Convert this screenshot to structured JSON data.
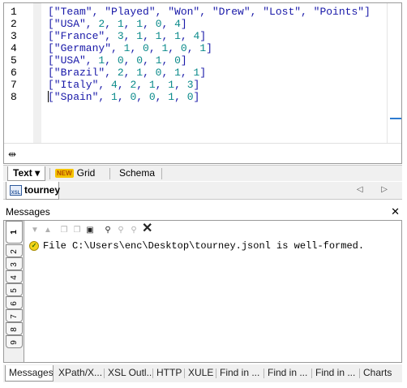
{
  "editor": {
    "line_numbers": [
      "1",
      "2",
      "3",
      "4",
      "5",
      "6",
      "7",
      "8"
    ],
    "lines": [
      [
        "[\"Team\", \"Played\", \"Won\", \"Drew\", \"Lost\", \"Points\"]"
      ],
      [
        "[\"USA\", ",
        "2",
        ", ",
        "1",
        ", ",
        "1",
        ", ",
        "0",
        ", ",
        "4",
        "]"
      ],
      [
        "[\"France\", ",
        "3",
        ", ",
        "1",
        ", ",
        "1",
        ", ",
        "1",
        ", ",
        "4",
        "]"
      ],
      [
        "[\"Germany\", ",
        "1",
        ", ",
        "0",
        ", ",
        "1",
        ", ",
        "0",
        ", ",
        "1",
        "]"
      ],
      [
        "[\"USA\", ",
        "1",
        ", ",
        "0",
        ", ",
        "0",
        ", ",
        "1",
        ", ",
        "0",
        "]"
      ],
      [
        "[\"Brazil\", ",
        "2",
        ", ",
        "1",
        ", ",
        "0",
        ", ",
        "1",
        ", ",
        "1",
        "]"
      ],
      [
        "[\"Italy\", ",
        "4",
        ", ",
        "2",
        ", ",
        "1",
        ", ",
        "1",
        ", ",
        "3",
        "]"
      ],
      [
        "[\"Spain\", ",
        "1",
        ", ",
        "0",
        ", ",
        "0",
        ", ",
        "1",
        ", ",
        "0",
        "]"
      ]
    ]
  },
  "view_tabs": {
    "text": "Text ▾",
    "new_badge": "NEW",
    "grid": "Grid",
    "schema": "Schema"
  },
  "document": {
    "tab_label": "tourney",
    "icon_text": "XSL",
    "nav_arrows": "◁ ▷"
  },
  "messages": {
    "title": "Messages",
    "close": "✕",
    "side_tabs": [
      "1",
      "2",
      "3",
      "4",
      "5",
      "6",
      "7",
      "8",
      "9"
    ],
    "status_icon": "✓",
    "text": "File C:\\Users\\enc\\Desktop\\tourney.jsonl is well-formed."
  },
  "bottom_tabs": [
    "Messages",
    "XPath/X...",
    "XSL Outl...",
    "HTTP",
    "XULE",
    "Find in ...",
    "Find in ...",
    "Find in ...",
    "Charts"
  ],
  "colors": {
    "string": "#1818a8",
    "number": "#0a8a8a",
    "accent": "#2d7bd1",
    "badge": "#f5c400"
  }
}
